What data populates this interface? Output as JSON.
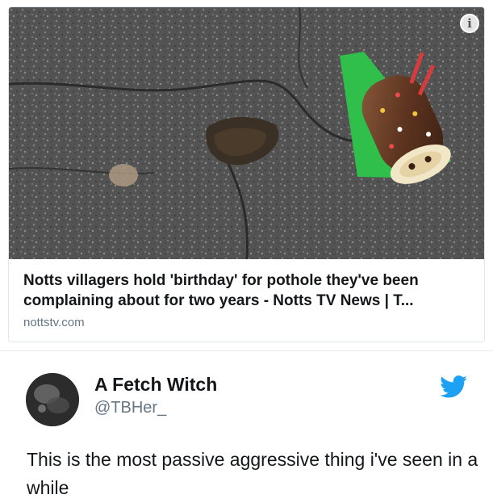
{
  "link_card": {
    "title": "Notts villagers hold 'birthday' for pothole they've been complaining about for two years - Notts TV News | T...",
    "domain": "nottstv.com",
    "info_icon": "info-icon"
  },
  "tweet": {
    "author_name": "A Fetch Witch",
    "author_handle": "@TBHer_",
    "text": "This is the most passive aggressive thing i've seen in a while",
    "brand_icon": "twitter-bird-icon"
  },
  "colors": {
    "twitter_blue": "#1da1f2",
    "secondary_text": "#657786",
    "primary_text": "#14171a",
    "border": "#e1e8ed"
  }
}
